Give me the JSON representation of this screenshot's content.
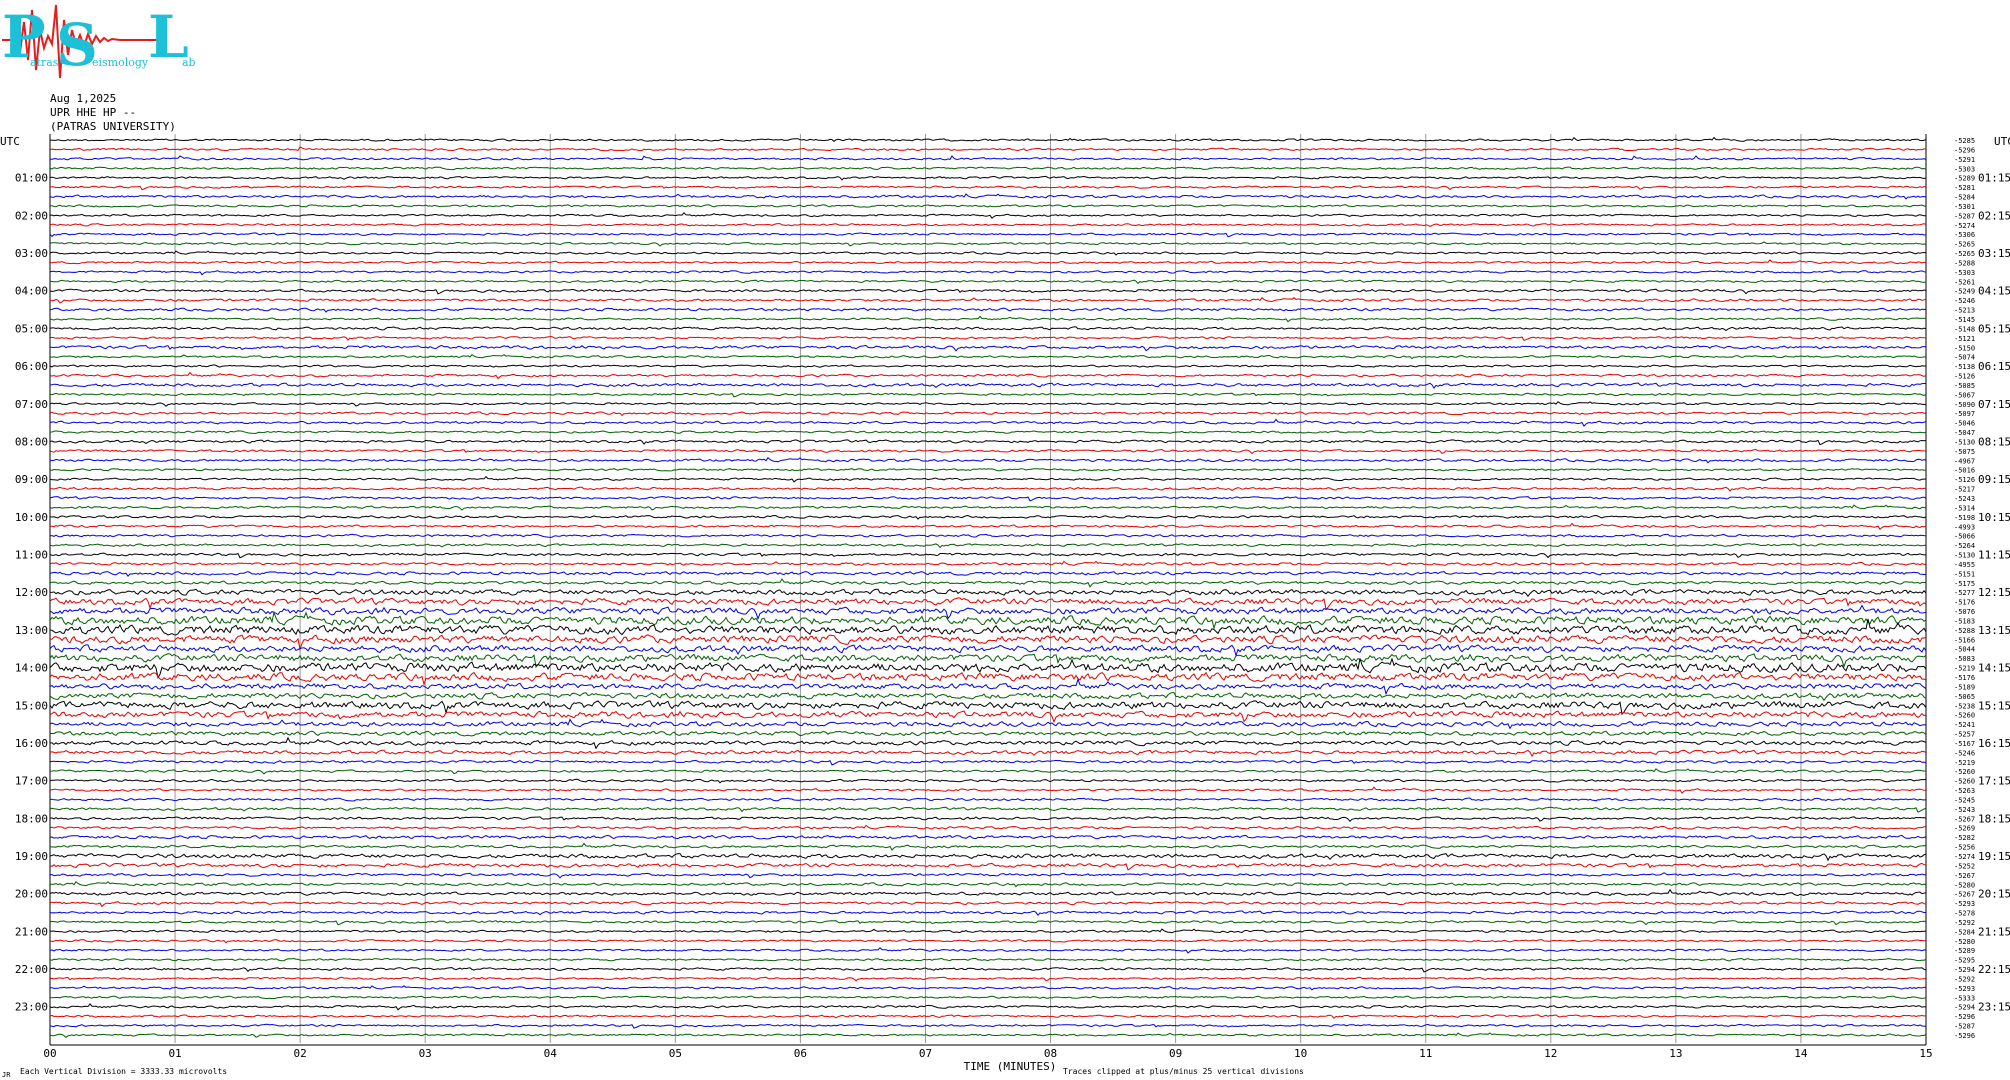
{
  "logo": {
    "letter1": "P",
    "letter2": "S",
    "letter3": "L",
    "subtitle_word1": "atras",
    "subtitle_word2": "eismology",
    "subtitle_word3": "ab"
  },
  "header": {
    "date": "Aug 1,2025",
    "station": "UPR HHE HP --",
    "institution": "(PATRAS UNIVERSITY)"
  },
  "footer": {
    "vertical_division": "Each Vertical Division = 3333.33 microvolts",
    "clip_note": "Traces clipped at plus/minus 25 vertical divisions",
    "corner_mark": "JR"
  },
  "colors": {
    "trace_cycle": [
      "#000000",
      "#e00000",
      "#0000e0",
      "#006000"
    ],
    "grid": "#999999",
    "logo": "#1ec0d8",
    "logo_wave": "#e02020"
  },
  "chart_data": {
    "type": "line",
    "title": "",
    "xlabel": "TIME (MINUTES)",
    "ylabel_left": "UTC",
    "ylabel_right": "UTC",
    "xlim": [
      0,
      15
    ],
    "x_ticks": [
      "00",
      "01",
      "02",
      "03",
      "04",
      "05",
      "06",
      "07",
      "08",
      "09",
      "10",
      "11",
      "12",
      "13",
      "14",
      "15"
    ],
    "lines_per_hour": 4,
    "minutes_per_line": 15,
    "left_hour_labels": [
      "01:00",
      "02:00",
      "03:00",
      "04:00",
      "05:00",
      "06:00",
      "07:00",
      "08:00",
      "09:00",
      "10:00",
      "11:00",
      "12:00",
      "13:00",
      "14:00",
      "15:00",
      "16:00",
      "17:00",
      "18:00",
      "19:00",
      "20:00",
      "21:00",
      "22:00",
      "23:00"
    ],
    "right_hour_labels": [
      "01:15",
      "02:15",
      "03:15",
      "04:15",
      "05:15",
      "06:15",
      "07:15",
      "08:15",
      "09:15",
      "10:15",
      "11:15",
      "12:15",
      "13:15",
      "14:15",
      "15:15",
      "16:15",
      "17:15",
      "18:15",
      "19:15",
      "20:15",
      "21:15",
      "22:15",
      "23:15"
    ],
    "line_offsets": [
      "-5285",
      "-5296",
      "-5291",
      "-5303",
      "-5289",
      "-5281",
      "-5284",
      "-5301",
      "-5287",
      "-5274",
      "-5306",
      "-5265",
      "-5265",
      "-5288",
      "-5303",
      "-5261",
      "-5249",
      "-5246",
      "-5213",
      "-5145",
      "-5148",
      "-5121",
      "-5150",
      "-5074",
      "-5138",
      "-5126",
      "-5085",
      "-5067",
      "-5090",
      "-5097",
      "-5046",
      "-5047",
      "-5130",
      "-5075",
      "-4967",
      "-5016",
      "-5126",
      "-5217",
      "-5243",
      "-5314",
      "-5198",
      "-4993",
      "-5066",
      "-5264",
      "-5130",
      "-4955",
      "-5151",
      "-5175",
      "-5277",
      "-5176",
      "-5076",
      "-5183",
      "-5288",
      "-5166",
      "-5044",
      "-5083",
      "-5219",
      "-5176",
      "-5189",
      "-5065",
      "-5238",
      "-5260",
      "-5241",
      "-5257",
      "-5167",
      "-5246",
      "-5219",
      "-5260",
      "-5260",
      "-5263",
      "-5245",
      "-5243",
      "-5267",
      "-5269",
      "-5282",
      "-5256",
      "-5274",
      "-5252",
      "-5267",
      "-5280",
      "-5267",
      "-5293",
      "-5278",
      "-5292",
      "-5284",
      "-5280",
      "-5289",
      "-5295",
      "-5294",
      "-5292",
      "-5293",
      "-5333",
      "-5294",
      "-5296",
      "-5287",
      "-5296"
    ],
    "activity_by_line": [
      0.8,
      0.8,
      0.8,
      0.8,
      0.8,
      0.8,
      1.0,
      0.8,
      0.8,
      0.8,
      0.8,
      0.8,
      0.8,
      0.8,
      0.8,
      0.8,
      1.0,
      1.0,
      1.0,
      0.8,
      1.0,
      0.8,
      1.2,
      0.8,
      0.8,
      0.9,
      1.2,
      0.8,
      0.8,
      0.9,
      1.0,
      0.8,
      1.0,
      0.9,
      1.0,
      0.8,
      0.8,
      0.9,
      0.9,
      0.9,
      0.9,
      0.9,
      0.9,
      0.9,
      1.0,
      1.0,
      1.2,
      1.2,
      2.0,
      2.4,
      2.6,
      3.2,
      3.4,
      3.0,
      2.6,
      2.8,
      3.6,
      3.0,
      2.2,
      2.2,
      2.8,
      2.4,
      1.8,
      1.6,
      1.6,
      1.4,
      1.0,
      0.9,
      0.9,
      0.9,
      0.9,
      1.0,
      1.0,
      0.9,
      1.2,
      1.0,
      1.6,
      1.4,
      1.0,
      1.0,
      1.2,
      1.0,
      1.0,
      0.9,
      0.9,
      0.8,
      0.8,
      0.8,
      0.9,
      0.8,
      0.8,
      0.8,
      0.9,
      0.8,
      0.8,
      0.8
    ]
  }
}
